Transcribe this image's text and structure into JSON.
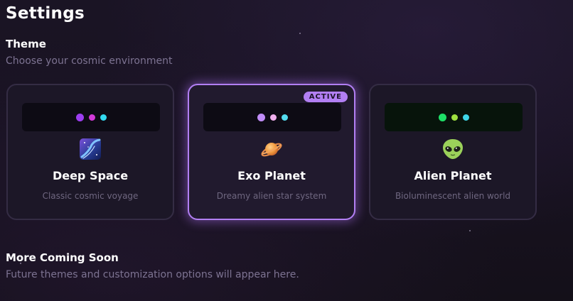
{
  "page": {
    "title": "Settings"
  },
  "theme_section": {
    "heading": "Theme",
    "subheading": "Choose your cosmic environment"
  },
  "themes": [
    {
      "name": "Deep Space",
      "description": "Classic cosmic voyage",
      "icon": "deep-space-icon",
      "active": false,
      "dot_colors": [
        "#9c3ef0",
        "#d33ad8",
        "#33d9ef"
      ]
    },
    {
      "name": "Exo Planet",
      "description": "Dreamy alien star system",
      "icon": "ringed-planet-icon",
      "active": true,
      "badge": "ACTIVE",
      "dot_colors": [
        "#c08df8",
        "#f0b0ee",
        "#54dcef"
      ]
    },
    {
      "name": "Alien Planet",
      "description": "Bioluminescent alien world",
      "icon": "alien-icon",
      "active": false,
      "dot_colors": [
        "#1ee067",
        "#9ee23f",
        "#3ed6e7"
      ]
    }
  ],
  "more_section": {
    "heading": "More Coming Soon",
    "subheading": "Future themes and customization options will appear here."
  },
  "colors": {
    "accent": "#b27ff3",
    "background": "#181221",
    "card_background": "#1c1727",
    "muted_text": "#7d7392"
  }
}
